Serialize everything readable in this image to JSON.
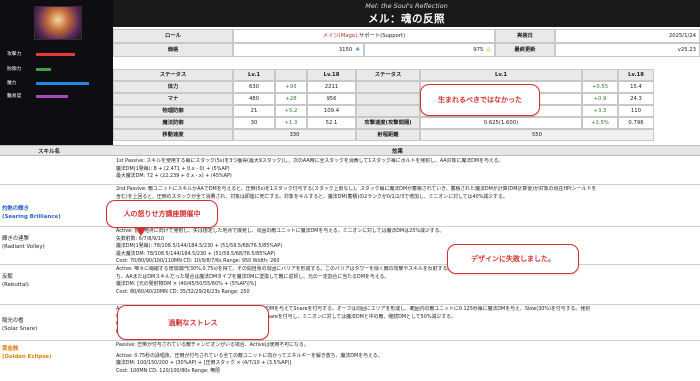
{
  "champion": {
    "subtitle": "Mel: the Soul's Reflection",
    "title": "メル：魂の反照"
  },
  "stat_bars": [
    {
      "label": "攻撃力",
      "color": "#e53935",
      "value": 0.55
    },
    {
      "label": "防御力",
      "color": "#43a047",
      "value": 0.22
    },
    {
      "label": "魔力",
      "color": "#1e88e5",
      "value": 0.75
    },
    {
      "label": "難易度",
      "color": "#ab47bc",
      "value": 0.45
    }
  ],
  "info": {
    "role_label": "ロール",
    "role_primary": "メイジ(Mage)",
    "role_sep": ", ",
    "role_secondary": "サポート(Support)",
    "release_label": "実装日",
    "release_value": "2025/1/24",
    "price_label": "価格",
    "price_be": "3150",
    "price_rp": "975",
    "update_label": "最終更新",
    "update_value": "v25.23"
  },
  "stats_table": {
    "headers": [
      "ステータス",
      "Lv.1",
      "",
      "Lv.18",
      "ステータス",
      "Lv.1",
      "",
      "Lv.18"
    ],
    "left": [
      {
        "name": "体力",
        "lv1": "630",
        "growth": "+93",
        "lv18": "2211"
      },
      {
        "name": "マナ",
        "lv1": "480",
        "growth": "+28",
        "lv18": "956"
      },
      {
        "name": "物理防御",
        "lv1": "21",
        "growth": "+5.2",
        "lv18": "109.4"
      },
      {
        "name": "魔法防御",
        "lv1": "30",
        "growth": "+1.3",
        "lv18": "52.1"
      },
      {
        "name": "移動速度",
        "lv1": "330",
        "growth": "",
        "lv18": ""
      }
    ],
    "right": [
      {
        "name": "",
        "lv1": "6",
        "growth": "+0.55",
        "lv18": "15.4"
      },
      {
        "name": "",
        "lv1": "9",
        "growth": "+0.9",
        "lv18": "24.3"
      },
      {
        "name": "",
        "lv1": "54",
        "growth": "+3.3",
        "lv18": "110"
      },
      {
        "name": "攻撃速度(攻撃間隔)",
        "lv1": "0.625(1.600)",
        "growth": "+2.5%",
        "lv18": "0.796"
      },
      {
        "name": "射程距離",
        "lv1": "550",
        "growth": "",
        "lv18": ""
      }
    ]
  },
  "skills_header": {
    "name": "スキル名",
    "effect": "効果"
  },
  "skills": [
    {
      "jp": "",
      "en": "",
      "lines": [
        "1st Passive: スキルを使用する毎にスタック(5s)を3つ獲得(最大9スタック)し、次のAA時に全スタックを消費して1スタック毎にボルトを発射し、AA対象に魔法DMを与える。",
        "魔法DM(1発毎): 8 + (2.471 + 0.x - 0) + (5%AP)",
        "最大魔法DM: 72 + (22.239 + 0.x - x) + (45%AP)"
      ]
    },
    {
      "jp": "灼熱の輝き",
      "en": "(Searing Brilliance)",
      "lines": [
        "2nd Passive: 敵ユニットにスキルかAAでDMを与えると、圧倒(5s)を1スタック付与する(スタック上限なし)。スタック毎に魔法DMが蓄積されていき、蓄積された魔法DMが計算(DM計算後)が対象の現在HP(シールドを",
        "含む)を上回ると、圧倒のスタックが全て消費され、対象は即座に死亡する。対象をキルすると、魔法DM(蓄積)の2ランクが0/1/2/3で増加し、ミニオンに対しては40%減少する。",
        "魔法DM: 7 + 1 + x (AP)",
        "全体DM: x + 1 (%AP)"
      ]
    },
    {
      "jp": "輝きの連撃",
      "en": "(Radiant Volley)",
      "lines": [
        "Active: 指定地点に向けて発射し、失は指定した地点で爆発し、周囲の敵ユニットに魔法DMを与える。ミニオンに対しては魔法DMは25%減少する。",
        "矢数射数: 6/7/8/9/10",
        "魔法DM(1発毎): 78/108.5/144/184.5/230 + (51/59.5/68/76.5/85%AP)",
        "最大魔法DM: 78/108.5/144/184.5/230 + (51/59.5/68/76.5/85%AP)",
        "Cost: 70/80/90/100/110MN   CD: 10/9/8/7/6s   Range: 950   Width: 260"
      ]
    },
    {
      "jp": "反駁",
      "en": "(Rebuttal)",
      "lines": [
        "Active: 唯々に縮縮する増加関門(30%,0.75s)を得て、その間自身の周囲にバリアを形成する。このバリアはタワーを除く敵の攻撃やスキルを反射する。反射された発射物は元と同じ機能を持",
        "ち、AAまたはDMスキルだった場合は魔法DMタイプを魔法DMに変換して敵に返却し、元の一定割合に当たるDMを与える。",
        "魔法DM: [元の発射物DM × (40/45/50/55/60% + (5%AP))%]",
        "Cost: 80/60/40/20MN   CD: 35/32/29/26/23s   Range: 250"
      ]
    },
    {
      "jp": "陽光の檻",
      "en": "(Solar Snare)",
      "lines": [
        "Active: 指定方向にオーブを発射し、中心部にいる敵ユニットに魔法DMを与えてSnareを付与する。オーブは周囲にエリアを形成し、範囲内の敵ユニットに0.125秒毎に魔法DMを与え、Slow(30%)を付与する。発射",
        "物は中心の敵を1体ずつ貫通するが、中心部の敵に対してのみDMとSnareを付与し、ミニオンに対しては魔法DMと中の敵、継続DMとして50%減少する。",
        "Cost: 70/75/80/85/90MN   CD: x",
        "Range: 1050"
      ]
    },
    {
      "jp": "黄金蝕",
      "en": "(Golden Eclipse)",
      "lines": [
        "Passive: 圧倒が付与されている敵チャンピオンがいる場合、Activeは使用不可になる。",
        "",
        "Active: 0.75秒の詠唱後、圧倒が付与されている全ての敵ユニットに向かってエネルギーを解き放ち、魔法DMを与える。",
        "魔法DM: 100/150/200 + (30%AP) + [圧倒スタック × (4/7/10 + (3.5%AP)]",
        "Cost: 100MN   CD: 120/100/80s   Range: 無限"
      ]
    }
  ],
  "callouts": [
    {
      "text": "生まれるべきではなかった"
    },
    {
      "text": "人の怒りせ方講座開催中"
    },
    {
      "text": "デザインに失敗しました。"
    },
    {
      "text": "過剰なストレス"
    }
  ],
  "colors": {
    "header_bg": "#1a1a1a",
    "accent_red": "#c62828",
    "callout": "#d32f2f",
    "skill_blue": "#2a63c8",
    "skill_gold": "#d9820b"
  },
  "icons": [
    "be-icon",
    "rp-icon"
  ]
}
